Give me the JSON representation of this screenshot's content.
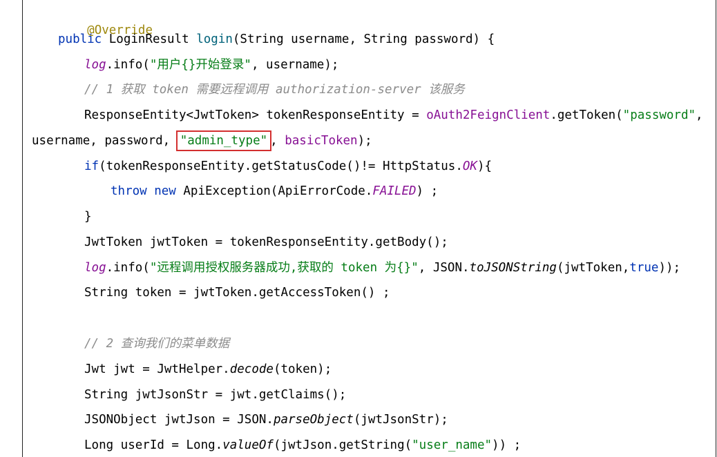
{
  "code": {
    "annotation": "@Override",
    "sig_kw": "public",
    "sig_type": " LoginResult ",
    "sig_name": "login",
    "sig_rest": "(String username, String password) {",
    "l3_log": "log",
    "l3_mid": ".info(",
    "l3_str": "\"用户{}开始登录\"",
    "l3_end": ", username);",
    "l4_comment": "// 1 获取 token 需要远程调用 authorization-server 该服务",
    "l5_a": "ResponseEntity<JwtToken> tokenResponseEntity = ",
    "l5_field": "oAuth2FeignClient",
    "l5_b": ".getToken(",
    "l5_str": "\"password\"",
    "l5_c": ",",
    "l6_a": "username, password, ",
    "l6_hl": "\"admin_type\"",
    "l6_b": ", ",
    "l6_field": "basicToken",
    "l6_c": ");",
    "l7_kw": "if",
    "l7_a": "(tokenResponseEntity.getStatusCode()!= HttpStatus.",
    "l7_const": "OK",
    "l7_b": "){",
    "l8_kw1": "throw",
    "l8_kw2": "new",
    "l8_a": " ApiException(ApiErrorCode.",
    "l8_const": "FAILED",
    "l8_b": ") ;",
    "l9": "}",
    "l10": "JwtToken jwtToken = tokenResponseEntity.getBody();",
    "l11_log": "log",
    "l11_mid": ".info(",
    "l11_str": "\"远程调用授权服务器成功,获取的 token 为{}\"",
    "l11_a": ", JSON.",
    "l11_it": "toJSONString",
    "l11_b": "(jwtToken,",
    "l11_kw": "true",
    "l11_c": "));",
    "l12": "String token = jwtToken.getAccessToken() ;",
    "l13_comment": "// 2 查询我们的菜单数据",
    "l14_a": "Jwt jwt = JwtHelper.",
    "l14_it": "decode",
    "l14_b": "(token);",
    "l15": "String jwtJsonStr = jwt.getClaims();",
    "l16_a": "JSONObject jwtJson = JSON.",
    "l16_it": "parseObject",
    "l16_b": "(jwtJsonStr);",
    "l17_a": "Long userId = Long.",
    "l17_it": "valueOf",
    "l17_b": "(jwtJson.getString(",
    "l17_str": "\"user_name\"",
    "l17_c": ")) ;"
  }
}
